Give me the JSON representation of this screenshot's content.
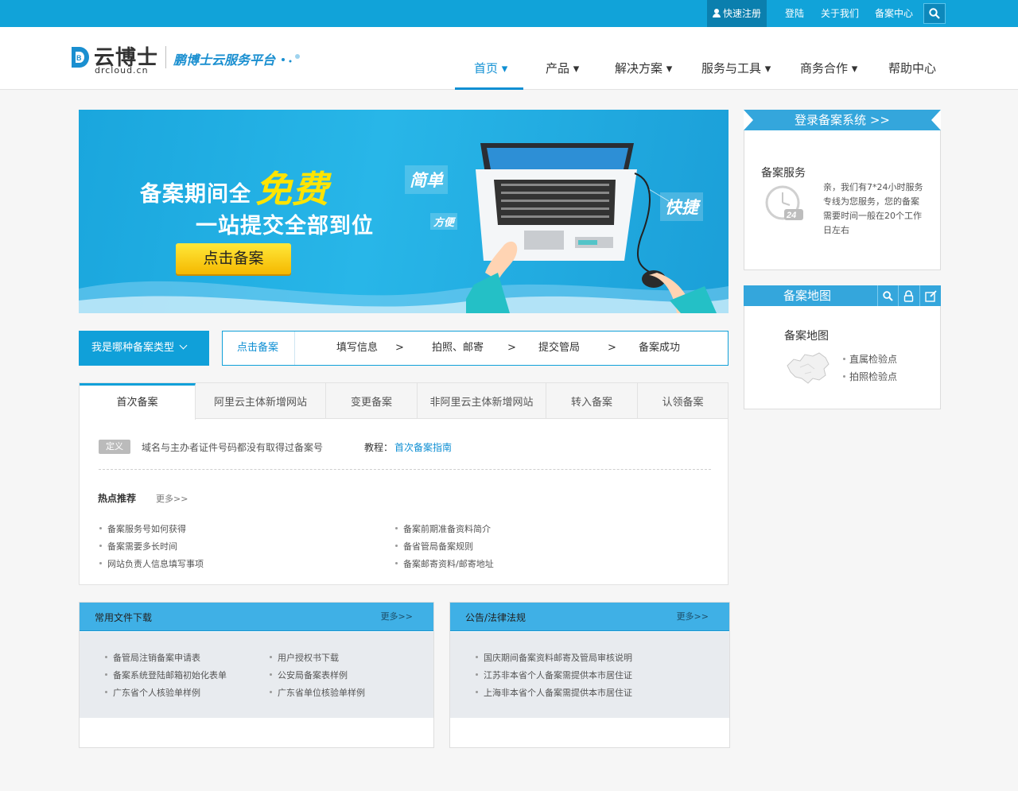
{
  "topbar": {
    "register": "快速注册",
    "login": "登陆",
    "about": "关于我们",
    "beian_center": "备案中心"
  },
  "header": {
    "logo_cn": "云博士",
    "logo_en": "drcloud.cn",
    "slogan": "鹏博士云服务平台",
    "nav": [
      "首页 ▾",
      "产品 ▾",
      "解决方案 ▾",
      "服务与工具 ▾",
      "商务合作 ▾",
      "帮助中心"
    ]
  },
  "banner": {
    "line1": "备案期间全",
    "highlight": "免费",
    "line2": "一站提交全部到位",
    "cta": "点击备案",
    "tag_simple": "简单",
    "tag_easy": "方便",
    "tag_fast": "快捷"
  },
  "process": {
    "type_button": "我是哪种备案类型",
    "steps": [
      "点击备案",
      "填写信息",
      "拍照、邮寄",
      "提交管局",
      "备案成功"
    ],
    "arrow": ">"
  },
  "tabs": {
    "items": [
      "首次备案",
      "阿里云主体新增网站",
      "变更备案",
      "非阿里云主体新增网站",
      "转入备案",
      "认领备案"
    ],
    "definition_badge": "定义",
    "definition_text": "域名与主办者证件号码都没有取得过备案号",
    "tutorial_label": "教程：",
    "tutorial_link": "首次备案指南",
    "hot_title": "热点推荐",
    "hot_more": "更多>>",
    "hot_left": [
      "备案服务号如何获得",
      "备案需要多长时间",
      "网站负责人信息填写事项"
    ],
    "hot_right": [
      "备案前期准备资料简介",
      "备省管局备案规则",
      "备案邮寄资料/邮寄地址"
    ]
  },
  "downloads": {
    "title": "常用文件下载",
    "more": "更多>>",
    "left": [
      "备管局注销备案申请表",
      "备案系统登陆邮箱初始化表单",
      "广东省个人核验单样例"
    ],
    "right": [
      "用户授权书下载",
      "公安局备案表样例",
      "广东省单位核验单样例"
    ]
  },
  "notices": {
    "title": "公告/法律法规",
    "more": "更多>>",
    "items": [
      "国庆期间备案资料邮寄及管局审核说明",
      "江苏非本省个人备案需提供本市居住证",
      "上海非本省个人备案需提供本市居住证"
    ]
  },
  "sidebar": {
    "login_system": "登录备案系统 >>",
    "service_title": "备案服务",
    "service_text": "亲，我们有7*24小时服务专线为您服务，您的备案需要时间一般在20个工作日左右",
    "clock_label": "24",
    "map_header": "备案地图",
    "map_title": "备案地图",
    "map_items": [
      "直属检验点",
      "拍照检验点"
    ]
  },
  "colors": {
    "brand_blue": "#11a3d9",
    "accent_yellow": "#ffe400",
    "link_blue": "#0f8fd3"
  }
}
